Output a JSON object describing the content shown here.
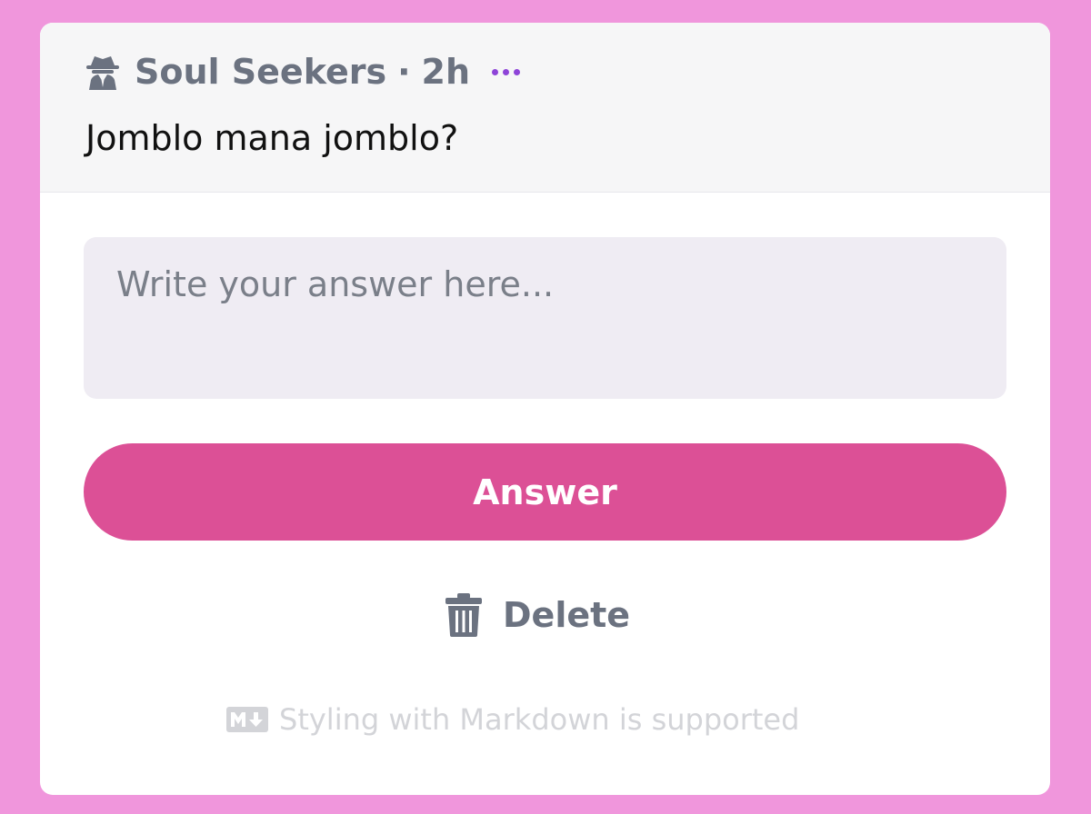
{
  "post": {
    "author": "Soul Seekers",
    "separator": "·",
    "time": "2h",
    "question": "Jomblo mana jomblo?",
    "icons": {
      "author": "spy-icon",
      "more": "more-options-icon"
    }
  },
  "answer": {
    "placeholder": "Write your answer here...",
    "value": "",
    "button_label": "Answer"
  },
  "actions": {
    "delete_label": "Delete",
    "delete_icon": "trash-icon"
  },
  "footer": {
    "note": "Styling with Markdown is supported",
    "icon": "markdown-icon"
  },
  "colors": {
    "background": "#f096dc",
    "accent": "#dc5096",
    "more_dots": "#8e44d8",
    "muted_text": "#6b7280",
    "input_bg": "#efecf3"
  }
}
